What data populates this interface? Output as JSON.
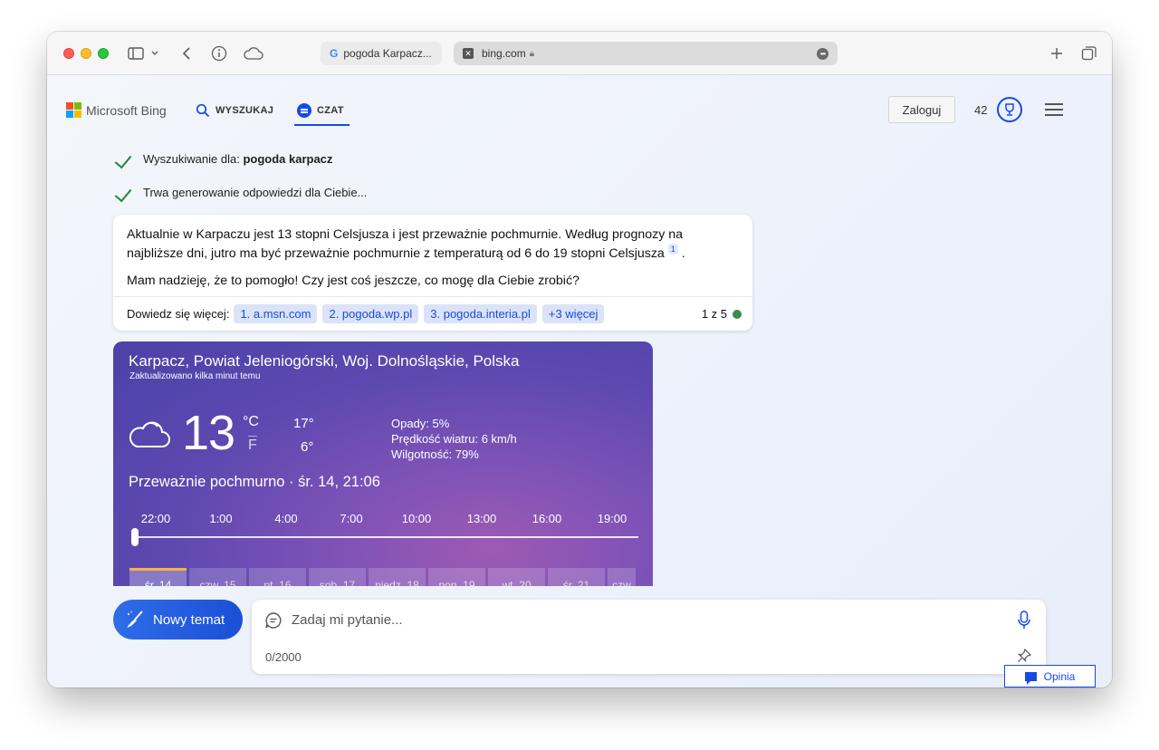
{
  "browser": {
    "tabs": [
      {
        "label": "pogoda Karpacz..."
      },
      {
        "label": "bing.com"
      }
    ]
  },
  "header": {
    "brand": "Microsoft Bing",
    "nav_search": "WYSZUKAJ",
    "nav_chat": "CZAT",
    "login": "Zaloguj",
    "points": "42"
  },
  "status": {
    "searching_prefix": "Wyszukiwanie dla: ",
    "searching_query": "pogoda karpacz",
    "generating": "Trwa generowanie odpowiedzi dla Ciebie..."
  },
  "response": {
    "paragraph1": "Aktualnie w Karpaczu jest 13 stopni Celsjusza i jest przeważnie pochmurnie. Według prognozy na najbliższe dni, jutro ma być przeważnie pochmurnie z temperaturą od 6 do 19 stopni Celsjusza",
    "citation": "1",
    "paragraph1_end": ".",
    "paragraph2": "Mam nadzieję, że to pomogło! Czy jest coś jeszcze, co mogę dla Ciebie zrobić?",
    "learn_more": "Dowiedz się więcej:",
    "sources": [
      "1. a.msn.com",
      "2. pogoda.wp.pl",
      "3. pogoda.interia.pl",
      "+3 więcej"
    ],
    "page_count": "1 z 5"
  },
  "weather": {
    "location": "Karpacz, Powiat Jeleniogórski, Woj. Dolnośląskie, Polska",
    "updated": "Zaktualizowano kilka minut temu",
    "temperature": "13",
    "unit_c": "°C",
    "unit_f": "F",
    "high": "17°",
    "low": "6°",
    "precip": "Opady: 5%",
    "wind": "Prędkość wiatru: 6 km/h",
    "humidity": "Wilgotność: 79%",
    "condition": "Przeważnie pochmurno · śr. 14, 21:06",
    "times": [
      "22:00",
      "1:00",
      "4:00",
      "7:00",
      "10:00",
      "13:00",
      "16:00",
      "19:00"
    ],
    "days": [
      "śr. 14",
      "czw. 15",
      "pt. 16",
      "sob. 17",
      "niedz. 18",
      "pon. 19",
      "wt. 20",
      "śr. 21",
      "czw"
    ]
  },
  "composer": {
    "new_topic": "Nowy temat",
    "placeholder": "Zadaj mi pytanie...",
    "char_count": "0/2000",
    "feedback": "Opinia"
  },
  "colors": {
    "accent": "#174ae4",
    "check_green": "#1c8a2f",
    "weather_top": "#4b41a8",
    "weather_glow": "#9d5ab3",
    "active_day": "#f7b33b"
  }
}
